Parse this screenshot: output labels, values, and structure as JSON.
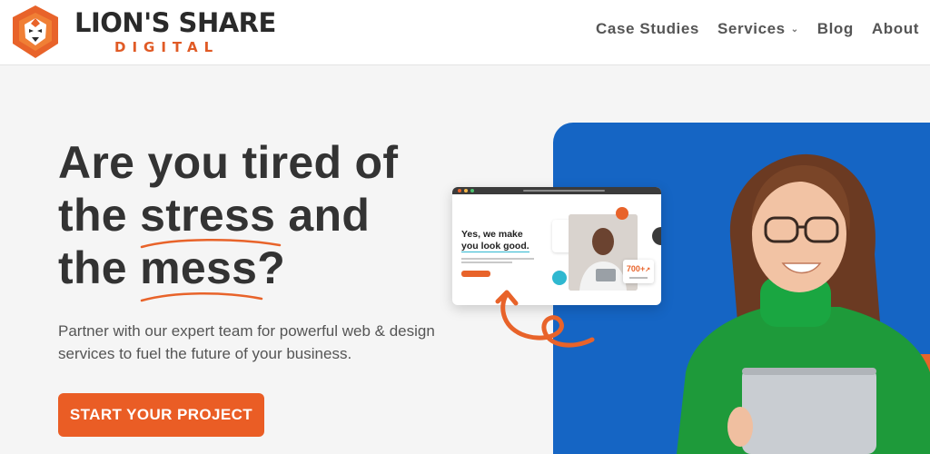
{
  "brand": {
    "name": "LION'S SHARE",
    "sub": "DIGITAL",
    "accent": "#ea5d25",
    "blue": "#1565c4"
  },
  "nav": {
    "items": [
      {
        "label": "Case Studies",
        "has_dropdown": false
      },
      {
        "label": "Services",
        "has_dropdown": true
      },
      {
        "label": "Blog",
        "has_dropdown": false
      },
      {
        "label": "About",
        "has_dropdown": false
      }
    ]
  },
  "hero": {
    "headline_line1": "Are you tired of",
    "headline_line2_pre": "the ",
    "headline_line2_word": "stress",
    "headline_line2_post": " and",
    "headline_line3_pre": "the ",
    "headline_line3_word": "mess",
    "headline_line3_post": "?",
    "subtext": "Partner with our expert team for powerful web & design services to fuel the future of your business.",
    "cta_label": "START YOUR PROJECT"
  },
  "mockup": {
    "title_line1": "Yes, we make",
    "title_line2": "you look good.",
    "stat_value": "700+",
    "stat_arrow": "↗"
  },
  "icons": [
    "lion-logo-icon",
    "chevron-down-icon",
    "arrow-doodle-icon"
  ]
}
